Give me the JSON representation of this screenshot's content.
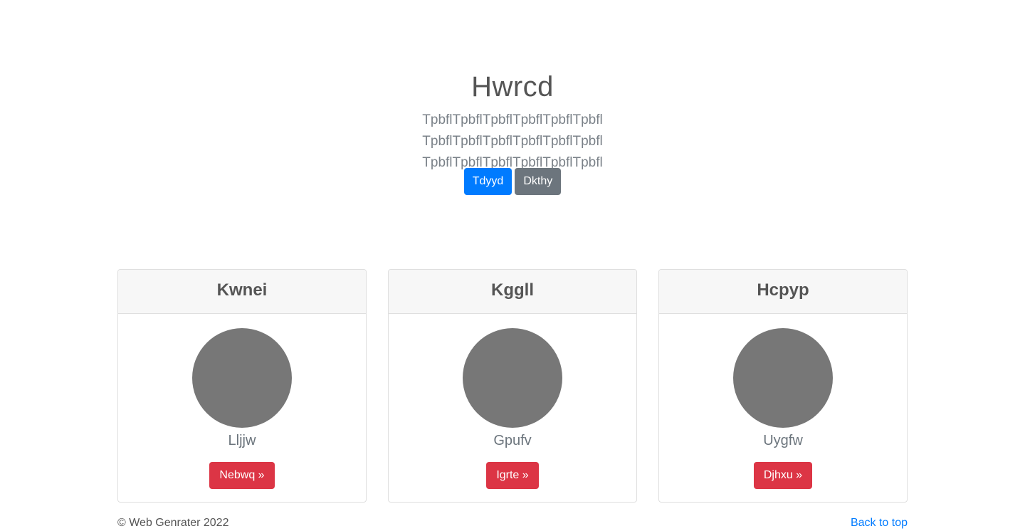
{
  "hero": {
    "title": "Hwrcd",
    "lead_line1": "TpbflTpbflTpbflTpbflTpbflTpbfl TpbflTpbflTpbflTpbflTpbflTpbfl",
    "lead_line2": "TpbflTpbflTpbflTpbflTpbflTpbfl",
    "primary_button": "Tdyyd",
    "secondary_button": "Dkthy"
  },
  "cards": [
    {
      "header": "Kwnei",
      "name": "Lljjw",
      "button": "Nebwq »"
    },
    {
      "header": "Kggll",
      "name": "Gpufv",
      "button": "Igrte »"
    },
    {
      "header": "Hcpyp",
      "name": "Uygfw",
      "button": "Djhxu »"
    }
  ],
  "footer": {
    "copyright": "© Web Genrater 2022",
    "back_to_top": "Back to top"
  },
  "colors": {
    "primary": "#007bff",
    "secondary": "#6c757d",
    "danger": "#dc3545",
    "avatar": "#777777"
  }
}
